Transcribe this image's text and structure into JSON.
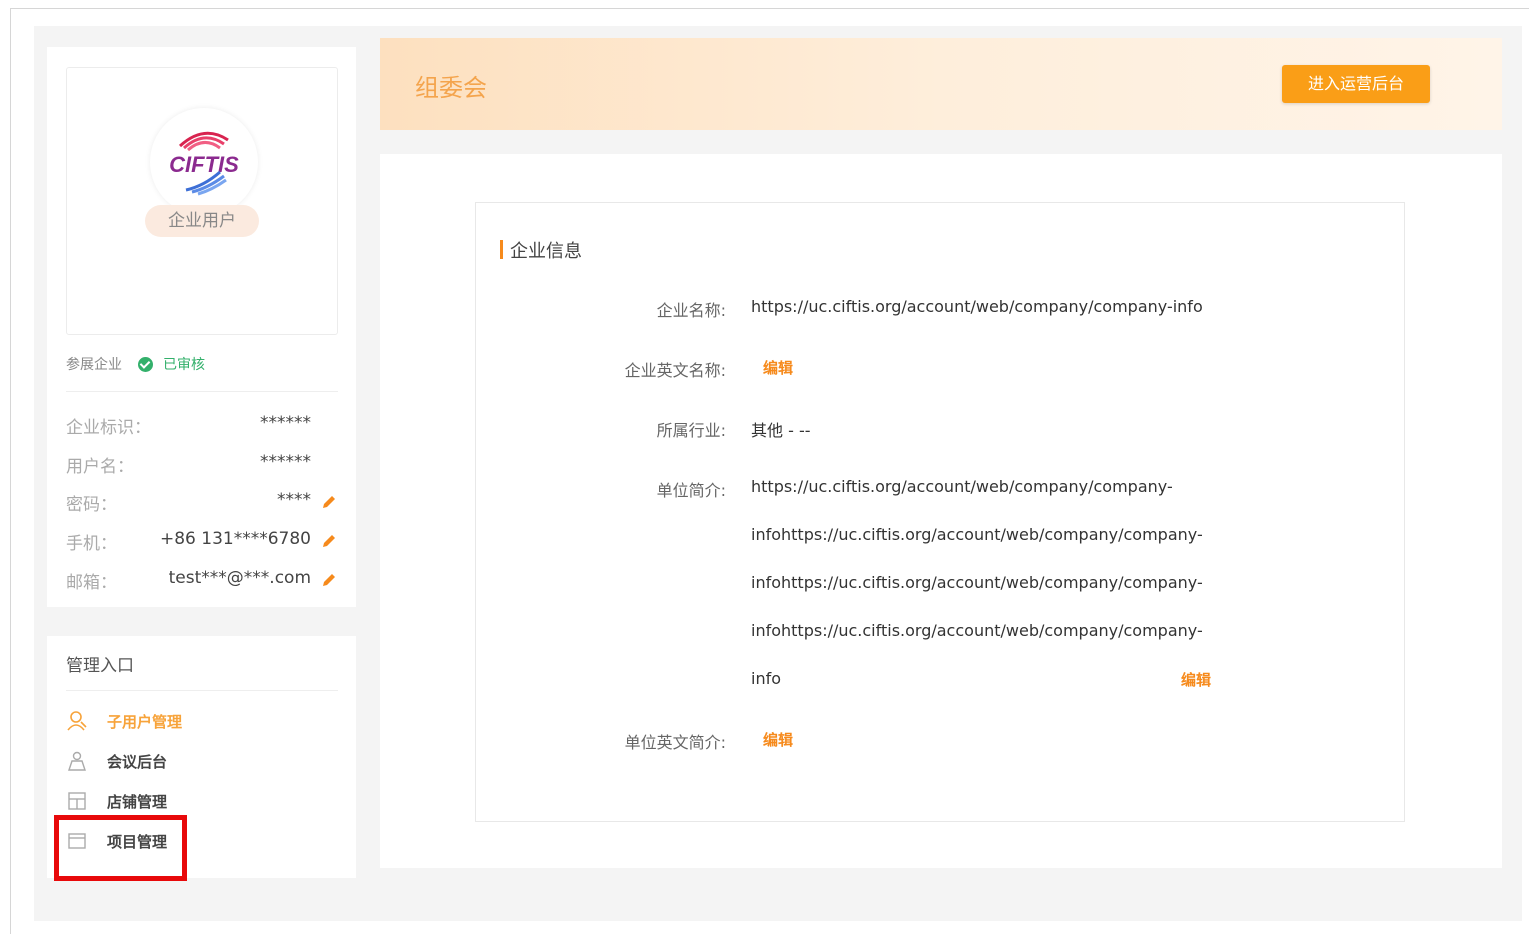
{
  "profile": {
    "user_type": "企业用户",
    "company_type": "参展企业",
    "status": "已审核",
    "rows": [
      {
        "label": "企业标识：",
        "value": "******"
      },
      {
        "label": "用户名：",
        "value": "******"
      },
      {
        "label": "密码：",
        "value": "****"
      },
      {
        "label": "手机：",
        "value": "+86  131****6780"
      },
      {
        "label": "邮箱：",
        "value": "test***@***.com"
      }
    ],
    "logo_text": "CIFTIS"
  },
  "management": {
    "title": "管理入口",
    "items": [
      {
        "label": "子用户管理",
        "icon": "user-icon"
      },
      {
        "label": "会议后台",
        "icon": "meeting-icon"
      },
      {
        "label": "店铺管理",
        "icon": "shop-icon"
      },
      {
        "label": "项目管理",
        "icon": "project-icon"
      }
    ]
  },
  "header": {
    "title": "组委会",
    "button_label": "进入运营后台"
  },
  "company_info": {
    "section_title": "企业信息",
    "fields": {
      "name_label": "企业名称:",
      "name_value": "https://uc.ciftis.org/account/web/company/company-info",
      "en_name_label": "企业英文名称:",
      "industry_label": "所属行业:",
      "industry_value": "其他 - --",
      "intro_label": "单位简介:",
      "intro_lines": [
        "https://uc.ciftis.org/account/web/company/company-",
        "infohttps://uc.ciftis.org/account/web/company/company-",
        "infohttps://uc.ciftis.org/account/web/company/company-",
        "infohttps://uc.ciftis.org/account/web/company/company-",
        "info"
      ],
      "en_intro_label": "单位英文简介:"
    },
    "edit_label": "编辑"
  },
  "colors": {
    "accent": "#fa9e17",
    "verified": "#33b06b",
    "highlight": "#e8090a"
  }
}
